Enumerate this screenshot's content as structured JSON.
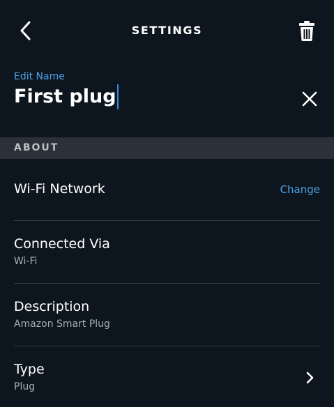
{
  "header": {
    "title": "SETTINGS",
    "back_icon": "chevron-left-icon",
    "delete_icon": "trash-icon"
  },
  "name_editor": {
    "label": "Edit Name",
    "value": "First plug",
    "clear_icon": "close-icon"
  },
  "about": {
    "section_title": "ABOUT",
    "items": [
      {
        "title": "Wi-Fi Network",
        "subtitle": "",
        "action": "Change"
      },
      {
        "title": "Connected Via",
        "subtitle": "Wi-Fi"
      },
      {
        "title": "Description",
        "subtitle": "Amazon Smart Plug"
      },
      {
        "title": "Type",
        "subtitle": "Plug",
        "icon": "chevron-right-icon"
      }
    ]
  },
  "colors": {
    "background": "#0d161e",
    "accent": "#4ea1e6",
    "section_header_bg": "#2a3138"
  }
}
